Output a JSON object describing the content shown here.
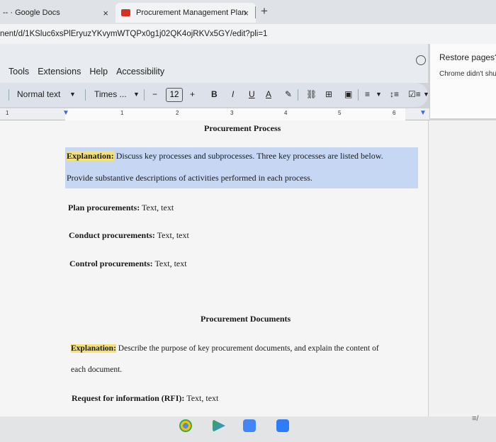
{
  "tabs": [
    {
      "label": "-- · Google Docs",
      "close": "×"
    },
    {
      "label": "Procurement Management Plan",
      "close": "×"
    }
  ],
  "new_tab": "+",
  "url": "nent/d/1KSluc6xsPlEryuzYKvymWTQPx0g1j02QK4ojRKVx5GY/edit?pli=1",
  "menu": [
    "Tools",
    "Extensions",
    "Help",
    "Accessibility"
  ],
  "toolbar": {
    "style": "Normal text",
    "font": "Times ...",
    "minus": "−",
    "font_size": "12",
    "plus": "+",
    "bold": "B",
    "italic": "I",
    "underline": "U",
    "text_color": "A"
  },
  "ruler": [
    "1",
    "1",
    "2",
    "3",
    "4",
    "5",
    "6"
  ],
  "restore": {
    "title": "Restore pages?",
    "subtitle": "Chrome didn't shu"
  },
  "doc": {
    "title1": "Procurement Process",
    "exp1_label": "Explanation:",
    "exp1_text": " Discuss key processes and subprocesses. Three key processes are listed below.",
    "exp1_line2": "Provide substantive descriptions of activities performed in each process.",
    "item1_label": "Plan procurements:",
    "item1_text": " Text, text",
    "item2_label": "Conduct procurements:",
    "item2_text": " Text, text",
    "item3_label": "Control procurements:",
    "item3_text": " Text, text",
    "title2": "Procurement Documents",
    "exp2_label": "Explanation:",
    "exp2_text": " Describe the purpose of key procurement documents, and explain the content of",
    "exp2_line2": "each document.",
    "item4_label": "Request for information (RFI):",
    "item4_text": " Text, text"
  },
  "colors": {
    "highlight": "#f3e27a",
    "selection": "#c5d7f2"
  }
}
